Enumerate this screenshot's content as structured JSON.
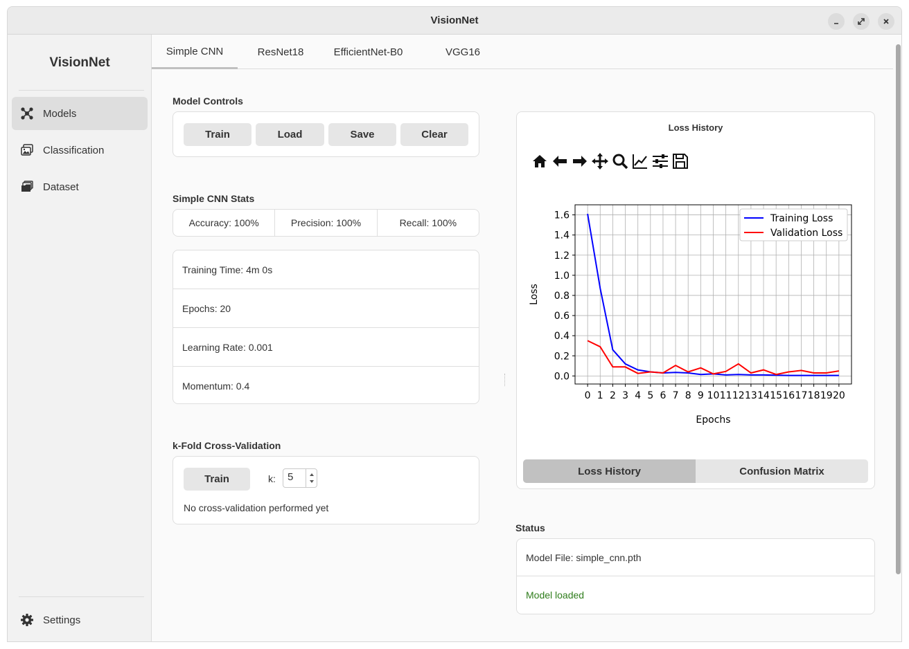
{
  "window": {
    "title": "VisionNet"
  },
  "sidebar": {
    "brand": "VisionNet",
    "items": [
      {
        "label": "Models",
        "icon": "models-icon",
        "active": true
      },
      {
        "label": "Classification",
        "icon": "images-icon",
        "active": false
      },
      {
        "label": "Dataset",
        "icon": "folders-icon",
        "active": false
      }
    ],
    "footer": {
      "label": "Settings",
      "icon": "gear-icon"
    }
  },
  "tabs": [
    {
      "label": "Simple CNN",
      "active": true
    },
    {
      "label": "ResNet18",
      "active": false
    },
    {
      "label": "EfficientNet-B0",
      "active": false
    },
    {
      "label": "VGG16",
      "active": false
    }
  ],
  "model_controls": {
    "title": "Model Controls",
    "train": "Train",
    "load": "Load",
    "save": "Save",
    "clear": "Clear"
  },
  "stats": {
    "title": "Simple CNN Stats",
    "accuracy": "Accuracy: 100%",
    "precision": "Precision: 100%",
    "recall": "Recall: 100%"
  },
  "details": {
    "training_time": "Training Time: 4m 0s",
    "epochs": "Epochs: 20",
    "learning_rate": "Learning Rate: 0.001",
    "momentum": "Momentum: 0.4"
  },
  "kfold": {
    "title": "k-Fold Cross-Validation",
    "train": "Train",
    "k_label": "k:",
    "k_value": "5",
    "message": "No cross-validation performed yet"
  },
  "plot_panel": {
    "title": "Loss History",
    "toolbar": [
      "home-icon",
      "back-arrow-icon",
      "forward-arrow-icon",
      "pan-icon",
      "zoom-icon",
      "edit-axis-icon",
      "configure-subplots-icon",
      "save-figure-icon"
    ],
    "toggle": {
      "loss": "Loss History",
      "confusion": "Confusion Matrix"
    }
  },
  "chart_data": {
    "type": "line",
    "title": "",
    "xlabel": "Epochs",
    "ylabel": "Loss",
    "x": [
      0,
      1,
      2,
      3,
      4,
      5,
      6,
      7,
      8,
      9,
      10,
      11,
      12,
      13,
      14,
      15,
      16,
      17,
      18,
      19,
      20
    ],
    "xlim": [
      -1,
      21
    ],
    "ylim": [
      -0.08,
      1.7
    ],
    "yticks": [
      0.0,
      0.2,
      0.4,
      0.6,
      0.8,
      1.0,
      1.2,
      1.4,
      1.6
    ],
    "grid": true,
    "legend": "top-right",
    "series": [
      {
        "name": "Training Loss",
        "color": "#0000ff",
        "values": [
          1.61,
          0.87,
          0.26,
          0.12,
          0.06,
          0.04,
          0.03,
          0.035,
          0.03,
          0.015,
          0.02,
          0.01,
          0.015,
          0.01,
          0.01,
          0.008,
          0.005,
          0.005,
          0.005,
          0.005,
          0.005
        ]
      },
      {
        "name": "Validation Loss",
        "color": "#ff0000",
        "values": [
          0.35,
          0.29,
          0.09,
          0.09,
          0.025,
          0.04,
          0.03,
          0.105,
          0.04,
          0.08,
          0.02,
          0.045,
          0.12,
          0.03,
          0.06,
          0.015,
          0.04,
          0.055,
          0.03,
          0.03,
          0.05
        ]
      }
    ]
  },
  "status": {
    "title": "Status",
    "model_file": "Model File: simple_cnn.pth",
    "state": "Model loaded"
  }
}
